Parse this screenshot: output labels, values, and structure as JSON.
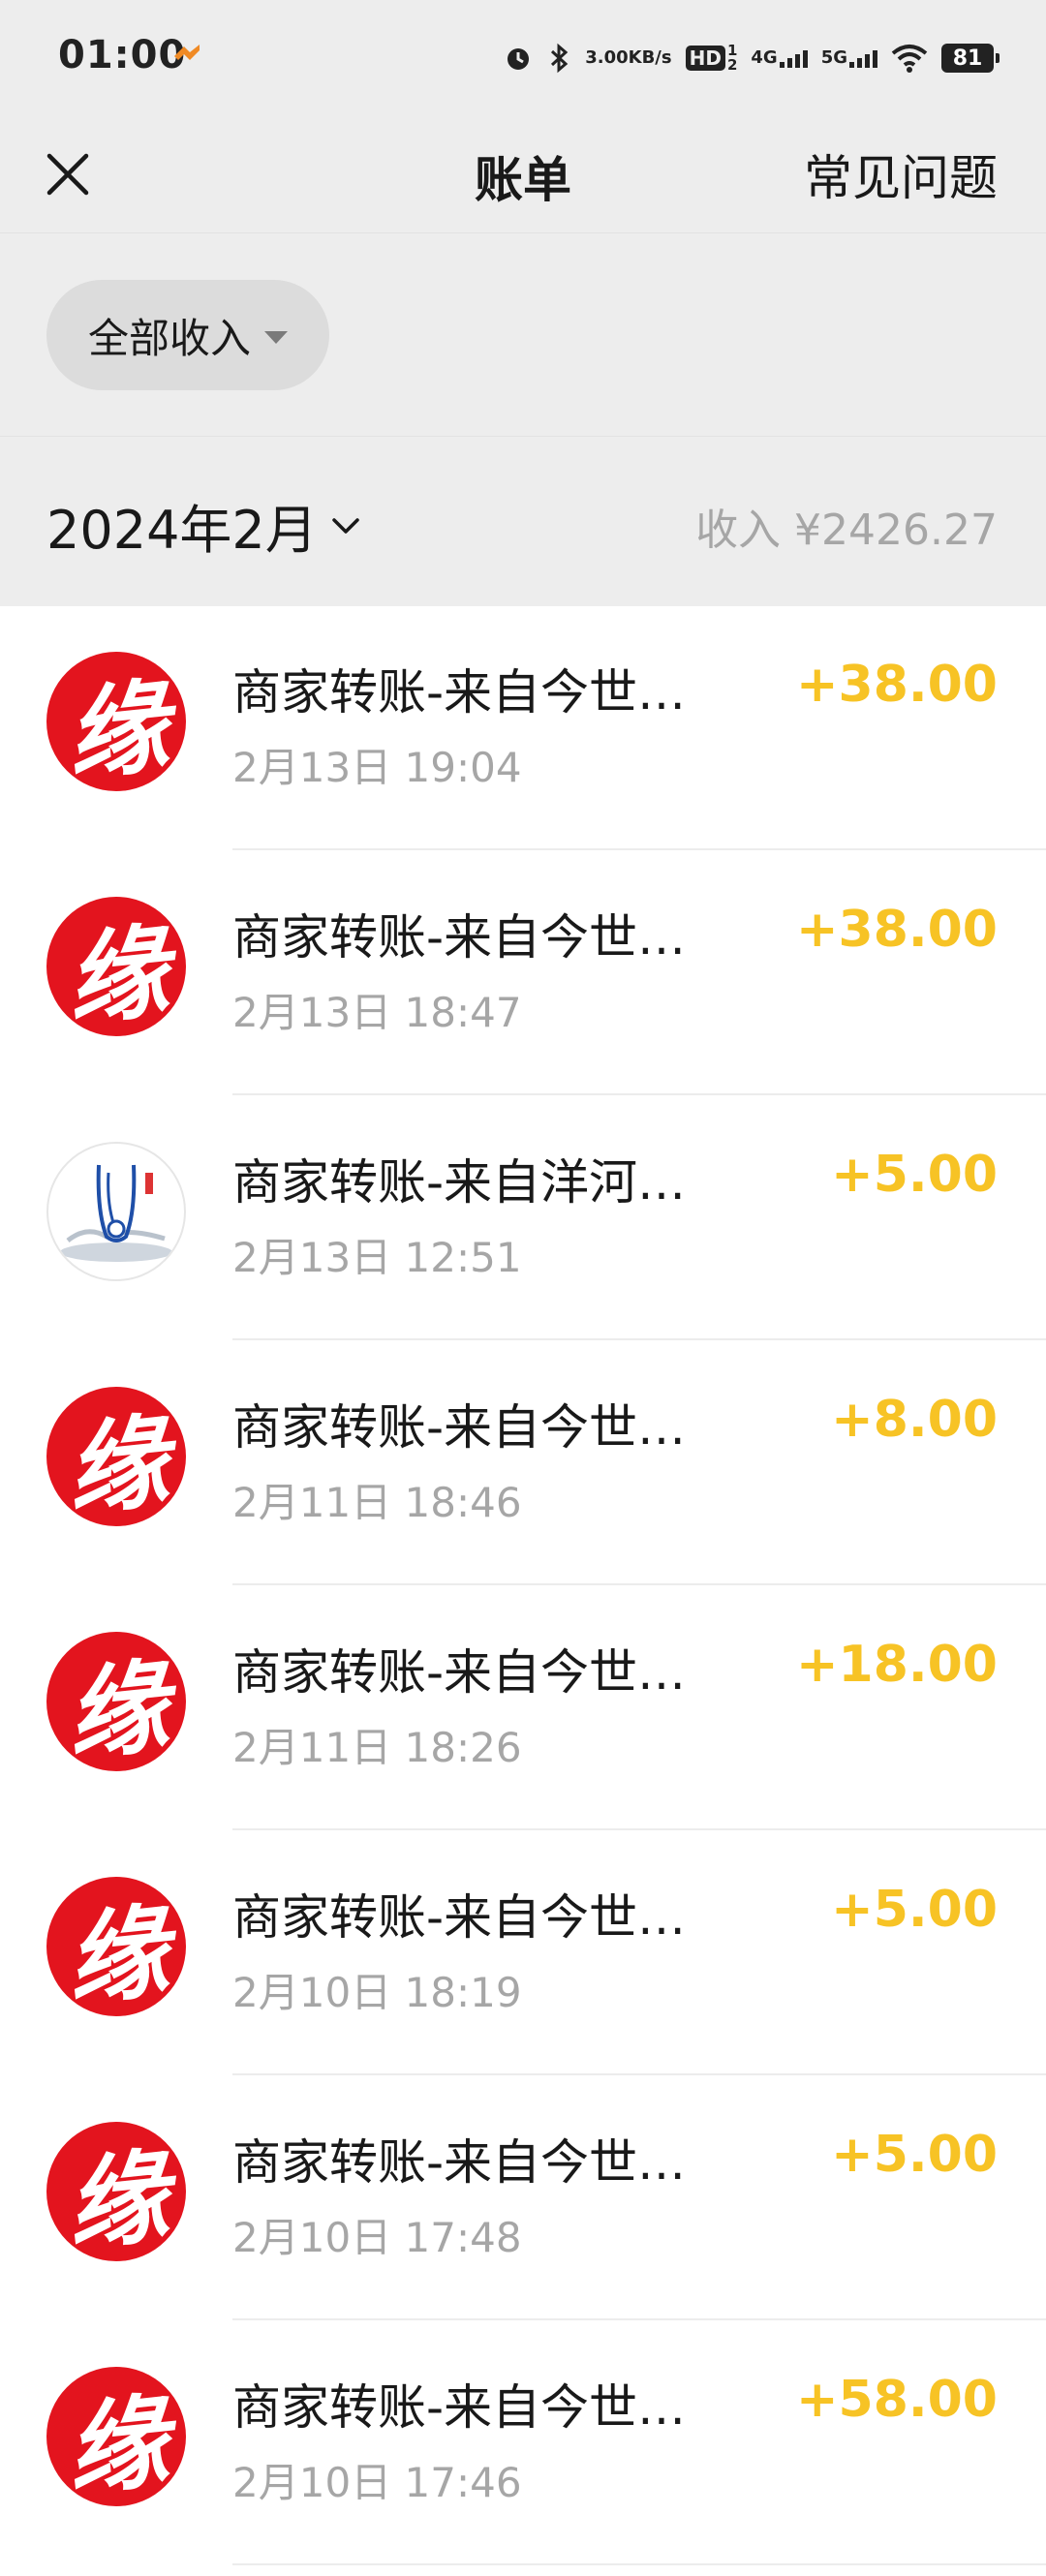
{
  "status_bar": {
    "time": "01:00",
    "speed_value": "3.00",
    "speed_unit": "KB/s",
    "hd": "HD",
    "hd_sup": "1",
    "hd_sub": "2",
    "net1": "4G",
    "net2": "5G",
    "battery": "81"
  },
  "nav": {
    "title": "账单",
    "faq": "常见问题",
    "close_icon": "close-icon"
  },
  "filter": {
    "label": "全部收入",
    "icon": "caret-down-icon"
  },
  "month": {
    "label": "2024年2月",
    "income": "收入 ¥2426.27"
  },
  "colors": {
    "amount": "#f7c325",
    "avatar_red": "#e3141e",
    "background": "#ededed",
    "secondary_text": "#a6a6a6"
  },
  "transactions": [
    {
      "title": "商家转账-来自今世…",
      "time": "2月13日 19:04",
      "amount": "+38.00",
      "avatar": "red-seal-avatar",
      "avatar_char": "缘"
    },
    {
      "title": "商家转账-来自今世…",
      "time": "2月13日 18:47",
      "amount": "+38.00",
      "avatar": "red-seal-avatar",
      "avatar_char": "缘"
    },
    {
      "title": "商家转账-来自洋河…",
      "time": "2月13日 12:51",
      "amount": "+5.00",
      "avatar": "ink-bottle-avatar"
    },
    {
      "title": "商家转账-来自今世…",
      "time": "2月11日 18:46",
      "amount": "+8.00",
      "avatar": "red-seal-avatar",
      "avatar_char": "缘"
    },
    {
      "title": "商家转账-来自今世…",
      "time": "2月11日 18:26",
      "amount": "+18.00",
      "avatar": "red-seal-avatar",
      "avatar_char": "缘"
    },
    {
      "title": "商家转账-来自今世…",
      "time": "2月10日 18:19",
      "amount": "+5.00",
      "avatar": "red-seal-avatar",
      "avatar_char": "缘"
    },
    {
      "title": "商家转账-来自今世…",
      "time": "2月10日 17:48",
      "amount": "+5.00",
      "avatar": "red-seal-avatar",
      "avatar_char": "缘"
    },
    {
      "title": "商家转账-来自今世…",
      "time": "2月10日 17:46",
      "amount": "+58.00",
      "avatar": "red-seal-avatar",
      "avatar_char": "缘"
    }
  ]
}
